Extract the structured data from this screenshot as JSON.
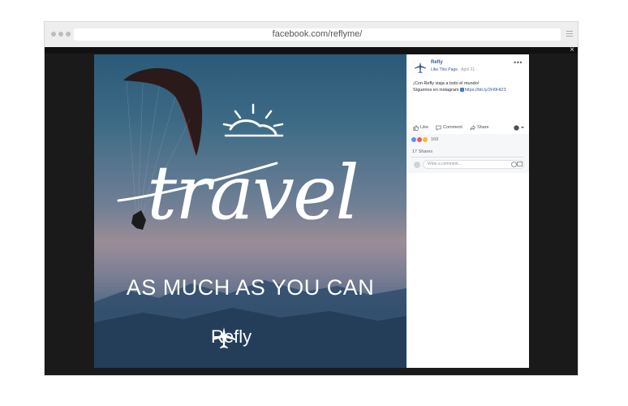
{
  "browser": {
    "url": "facebook.com/reflyme/"
  },
  "photo": {
    "headline": "travel",
    "tagline": "AS MUCH AS YOU CAN",
    "brand": "Refly"
  },
  "post": {
    "page_name": "Refly",
    "like_page": "Like This Page",
    "date": "· April 21 ·",
    "text_line1": "¡Con Refly viaja a todo el mundo!",
    "text_line2": "Síguenos en instagram",
    "link": "https://bit.ly/2H9Ht23",
    "actions": {
      "like": "Like",
      "comment": "Comment",
      "share": "Share"
    },
    "reactions_count": "169",
    "shares": "17 Shares",
    "comment_placeholder": "Write a comment..."
  },
  "colors": {
    "fb_blue": "#365899",
    "like_blue": "#5890ff",
    "love_red": "#f25268",
    "haha_yellow": "#f7b928"
  }
}
